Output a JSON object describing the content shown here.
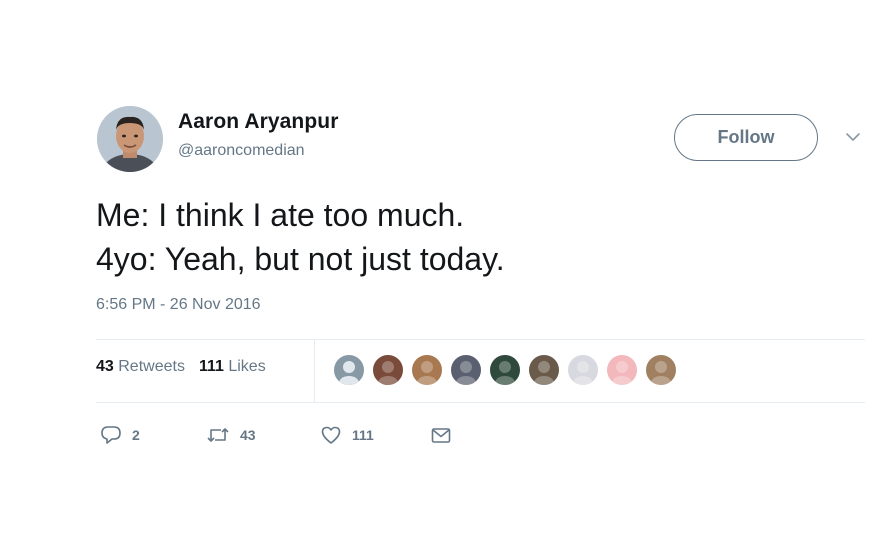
{
  "author": {
    "name": "Aaron Aryanpur",
    "handle": "@aaroncomedian",
    "avatar_icon": "person-avatar"
  },
  "follow_button": {
    "label": "Follow"
  },
  "caret_icon": "chevron-down-icon",
  "tweet": {
    "text": "Me: I think I ate too much.\n4yo: Yeah, but not just today.",
    "timestamp": "6:56 PM - 26 Nov 2016"
  },
  "stats": {
    "retweets_count": "43",
    "retweets_label": "Retweets",
    "likes_count": "111",
    "likes_label": "Likes"
  },
  "likers": [
    {
      "icon": "default-avatar",
      "color": "#8899a6"
    },
    {
      "icon": "user-avatar",
      "color": "#7a4a3a"
    },
    {
      "icon": "user-avatar",
      "color": "#a87850"
    },
    {
      "icon": "user-avatar",
      "color": "#5a6070"
    },
    {
      "icon": "user-avatar",
      "color": "#2f4a3c"
    },
    {
      "icon": "user-avatar",
      "color": "#6a5a4a"
    },
    {
      "icon": "user-avatar",
      "color": "#d8d8e0"
    },
    {
      "icon": "user-avatar",
      "color": "#f2b8bc"
    },
    {
      "icon": "user-avatar",
      "color": "#a08060"
    }
  ],
  "actions": {
    "reply_count": "2",
    "retweet_count": "43",
    "like_count": "111",
    "reply_icon": "reply-icon",
    "retweet_icon": "retweet-icon",
    "like_icon": "heart-icon",
    "message_icon": "mail-icon"
  },
  "colors": {
    "text_primary": "#14171a",
    "text_secondary": "#657786",
    "divider": "#e6ecf0"
  }
}
